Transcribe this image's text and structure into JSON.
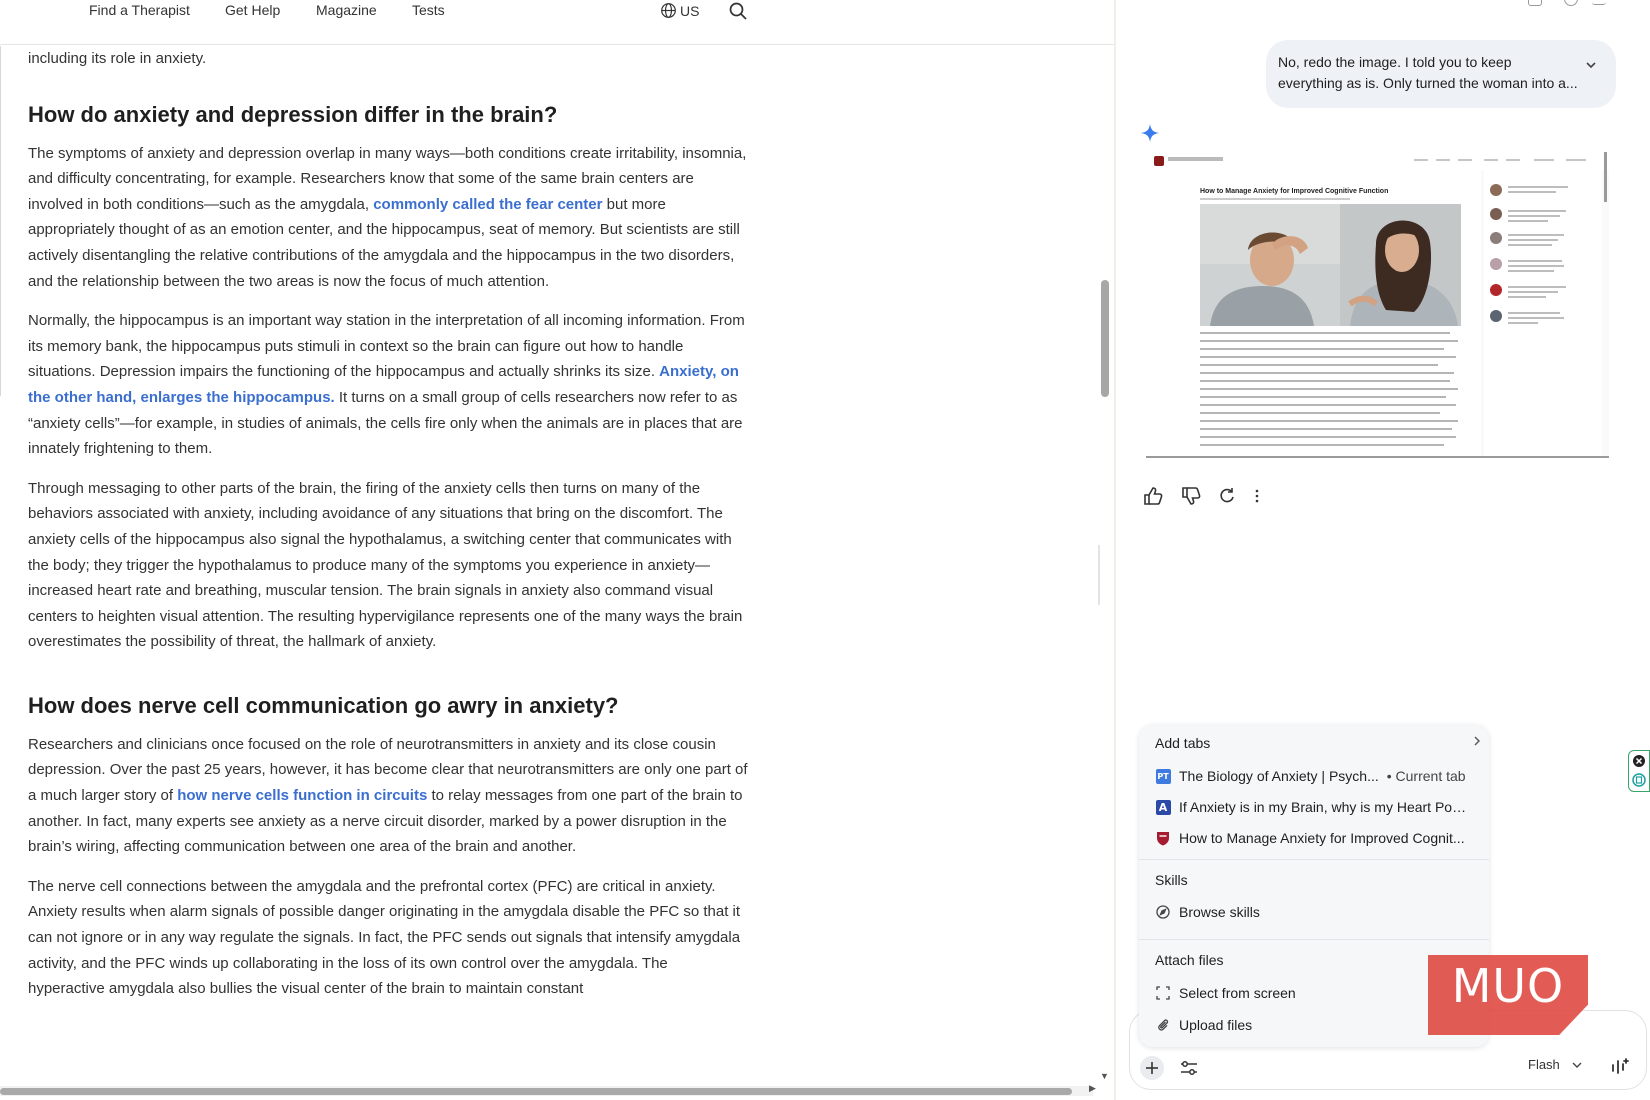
{
  "nav": {
    "links": [
      "Find a Therapist",
      "Get Help",
      "Magazine",
      "Tests"
    ],
    "region": "US"
  },
  "article": {
    "lead_fragment": "including its role in anxiety.",
    "heading1": "How do anxiety and depression differ in the brain?",
    "para1": {
      "before_link": "The symptoms of anxiety and depression overlap in many ways—both conditions create irritability, insomnia, and difficulty concentrating, for example. Researchers know that some of the same brain centers are involved in both conditions—such as the amygdala, ",
      "link": "commonly called the fear center",
      "after_link": " but more appropriately thought of as an emotion center, and the hippocampus, seat of memory. But scientists are still actively disentangling the relative contributions of the amygdala and the hippocampus in the two disorders, and the relationship between the two areas is now the focus of much attention."
    },
    "para2": {
      "before_link": "Normally, the hippocampus is an important way station in the interpretation of all incoming information. From its memory bank, the hippocampus puts stimuli in context so the brain can figure out how to handle situations. Depression impairs the functioning of the hippocampus and actually shrinks its size. ",
      "link": "Anxiety, on the other hand, enlarges the hippocampus.",
      "after_link": " It turns on a small group of cells researchers now refer to as “anxiety cells”—for example, in studies of animals, the cells fire only when the animals are in places that are innately frightening to them."
    },
    "para3": "Through messaging to other parts of the brain, the firing of the anxiety cells then turns on many of the behaviors associated with anxiety, including avoidance of any situations that bring on the discomfort. The anxiety cells of the hippocampus also signal the hypothalamus, a switching center that communicates with the body; they trigger the hypothalamus to produce many of the symptoms you experience in anxiety— increased heart rate and breathing, muscular tension. The brain signals in anxiety also command visual centers to heighten visual attention. The resulting hypervigilance represents one of the many ways the brain overestimates the possibility of threat, the hallmark of anxiety.",
    "heading2": "How does nerve cell communication go awry in anxiety?",
    "para4": {
      "before_link": "Researchers and clinicians once focused on the role of neurotransmitters in anxiety and its close cousin depression. Over the past 25 years, however, it has become clear that neurotransmitters are only one part of a much larger story of ",
      "link": "how nerve cells function in circuits",
      "after_link": " to relay messages from one part of the brain to another. In fact, many experts see anxiety as a nerve circuit disorder, marked by a power disruption in the brain’s wiring, affecting communication between one area of the brain and another."
    },
    "para5": "The nerve cell connections between the amygdala and the prefrontal cortex (PFC) are critical in anxiety. Anxiety results when alarm signals of possible danger originating in the amygdala disable the PFC so that it can not ignore or in any way regulate the signals. In fact, the PFC sends out signals that intensify amygdala activity, and the PFC winds up collaborating in the loss of its own control over the amygdala. The hyperactive amygdala also bullies the visual center of the brain to maintain constant"
  },
  "chat": {
    "user_message_line1": "No, redo the image. I told you to keep",
    "user_message_line2": "everything as is. Only turned the woman into a...",
    "generated_image": {
      "article_title": "How to Manage Anxiety for Improved Cognitive Function"
    }
  },
  "menu": {
    "add_tabs_label": "Add tabs",
    "tabs": [
      {
        "title": "The Biology of Anxiety | Psych...",
        "badge": "• Current tab",
        "icon": "psychology-today-favicon",
        "fav_text": "PT",
        "color": "#3d7be0"
      },
      {
        "title": "If Anxiety is in my Brain, why is my Heart Pou...",
        "badge": "",
        "icon": "letter-a-favicon",
        "fav_text": "A",
        "color": "#2b4aa8"
      },
      {
        "title": "How to Manage Anxiety for Improved Cognit...",
        "badge": "",
        "icon": "harvard-shield-favicon",
        "fav_text": "",
        "color": "#a51c30"
      }
    ],
    "skills_label": "Skills",
    "browse_skills": "Browse skills",
    "attach_label": "Attach files",
    "select_screen": "Select from screen",
    "upload_files": "Upload files"
  },
  "input": {
    "model": "Flash"
  },
  "watermark": "MUO"
}
